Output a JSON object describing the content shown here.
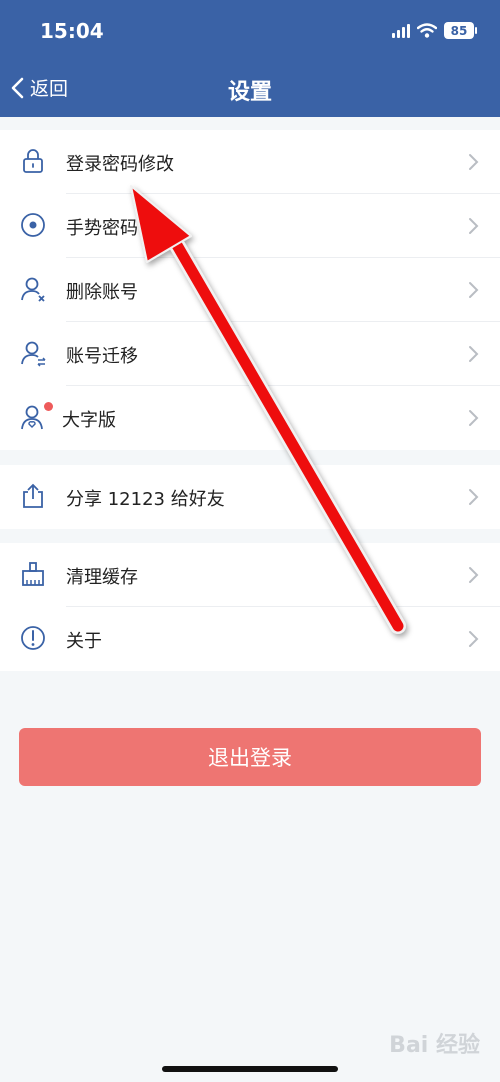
{
  "status_bar": {
    "time": "15:04",
    "battery": "85"
  },
  "nav": {
    "back_label": "返回",
    "title": "设置"
  },
  "group1": [
    {
      "label": "登录密码修改",
      "icon": "lock-icon"
    },
    {
      "label": "手势密码设置",
      "icon": "gesture-icon"
    },
    {
      "label": "删除账号",
      "icon": "user-delete-icon"
    },
    {
      "label": "账号迁移",
      "icon": "user-transfer-icon"
    },
    {
      "label": "大字版",
      "icon": "elder-mode-icon"
    }
  ],
  "group2": [
    {
      "label": "分享 12123 给好友",
      "icon": "share-icon"
    }
  ],
  "group3": [
    {
      "label": "清理缓存",
      "icon": "broom-icon"
    },
    {
      "label": "关于",
      "icon": "info-icon"
    }
  ],
  "logout_label": "退出登录",
  "watermark": "Bai 经验",
  "colors": {
    "header": "#3a62a6",
    "logout": "#ee7572",
    "arrow": "#ee1111",
    "badge": "#ee5b5b"
  }
}
